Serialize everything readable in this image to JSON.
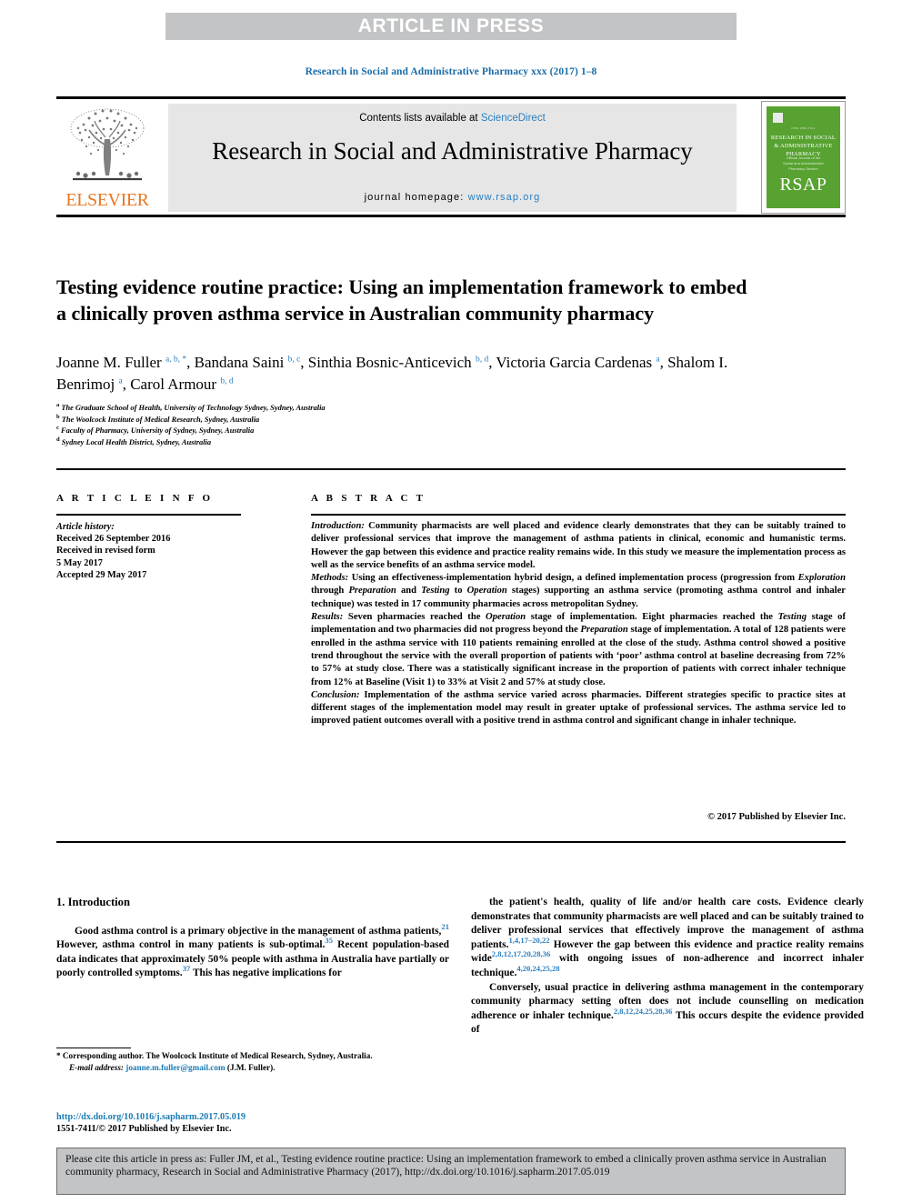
{
  "banner": {
    "label": "ARTICLE IN PRESS"
  },
  "running_head": {
    "text": "Research in Social and Administrative Pharmacy xxx (2017) 1–8"
  },
  "masthead": {
    "contents_prefix": "Contents lists available at ",
    "sciencedirect": "ScienceDirect",
    "journal_title": "Research in Social and Administrative Pharmacy",
    "homepage_label": "journal homepage: ",
    "homepage_url": "www.rsap.org",
    "publisher": "ELSEVIER",
    "cover": {
      "title": "RESEARCH IN SOCIAL & ADMINISTRATIVE PHARMACY",
      "acronym": "RSAP",
      "small_top": "ISSN 1551-7411",
      "sub": "Official Journal of the\nSocial and Administrative\nPharmacy Section"
    }
  },
  "article": {
    "title": "Testing evidence routine practice: Using an implementation framework to embed a clinically proven asthma service in Australian community pharmacy",
    "authors": [
      {
        "name": "Joanne M. Fuller",
        "marks": "a, b, *",
        "sep": ", "
      },
      {
        "name": "Bandana Saini",
        "marks": "b, c",
        "sep": ", "
      },
      {
        "name": "Sinthia Bosnic-Anticevich",
        "marks": "b, d",
        "sep": ", "
      },
      {
        "name": "Victoria Garcia Cardenas",
        "marks": "a",
        "sep": ", "
      },
      {
        "name": "Shalom I. Benrimoj",
        "marks": "a",
        "sep": ", "
      },
      {
        "name": "Carol Armour",
        "marks": "b, d",
        "sep": ""
      }
    ],
    "affiliations": [
      {
        "mark": "a",
        "text": "The Graduate School of Health, University of Technology Sydney, Sydney, Australia"
      },
      {
        "mark": "b",
        "text": "The Woolcock Institute of Medical Research, Sydney, Australia"
      },
      {
        "mark": "c",
        "text": "Faculty of Pharmacy, University of Sydney, Sydney, Australia"
      },
      {
        "mark": "d",
        "text": "Sydney Local Health District, Sydney, Australia"
      }
    ]
  },
  "article_info": {
    "heading": "A R T I C L E  I N F O",
    "history_label": "Article history:",
    "received": "Received 26 September 2016",
    "revised_label": "Received in revised form",
    "revised_date": "5 May 2017",
    "accepted": "Accepted 29 May 2017"
  },
  "abstract": {
    "heading": "A B S T R A C T",
    "sections": [
      {
        "label": "Introduction:",
        "text": " Community pharmacists are well placed and evidence clearly demonstrates that they can be suitably trained to deliver professional services that improve the management of asthma patients in clinical, economic and humanistic terms. However the gap between this evidence and practice reality remains wide. In this study we measure the implementation process as well as the service benefits of an asthma service model."
      },
      {
        "label": "Methods:",
        "text": " Using an effectiveness-implementation hybrid design, a defined implementation process (progression from Exploration through Preparation and Testing to Operation stages) supporting an asthma service (promoting asthma control and inhaler technique) was tested in 17 community pharmacies across metropolitan Sydney."
      },
      {
        "label": "Results:",
        "text": " Seven pharmacies reached the Operation stage of implementation. Eight pharmacies reached the Testing stage of implementation and two pharmacies did not progress beyond the Preparation stage of implementation. A total of 128 patients were enrolled in the asthma service with 110 patients remaining enrolled at the close of the study. Asthma control showed a positive trend throughout the service with the overall proportion of patients with ‘poor’ asthma control at baseline decreasing from 72% to 57% at study close. There was a statistically significant increase in the proportion of patients with correct inhaler technique from 12% at Baseline (Visit 1) to 33% at Visit 2 and 57% at study close."
      },
      {
        "label": "Conclusion:",
        "text": " Implementation of the asthma service varied across pharmacies. Different strategies specific to practice sites at different stages of the implementation model may result in greater uptake of professional services. The asthma service led to improved patient outcomes overall with a positive trend in asthma control and significant change in inhaler technique."
      }
    ],
    "copyright": "© 2017 Published by Elsevier Inc."
  },
  "body": {
    "section_number_title": "1. Introduction",
    "left_paragraphs": [
      "Good asthma control is a primary objective in the management of asthma patients,<sup class=\"ref\">21</sup> However, asthma control in many patients is sub-optimal.<sup class=\"ref\">35</sup> Recent population-based data indicates that approximately 50% people with asthma in Australia have partially or poorly controlled symptoms.<sup class=\"ref\">37</sup> This has negative implications for"
    ],
    "right_paragraphs": [
      "the patient's health, quality of life and/or health care costs. Evidence clearly demonstrates that community pharmacists are well placed and can be suitably trained to deliver professional services that effectively improve the management of asthma patients.<sup class=\"ref\">1,4,17–20,22</sup> However the gap between this evidence and practice reality remains wide<sup class=\"ref\">2,8,12,17,20,28,36</sup> with ongoing issues of non-adherence and incorrect inhaler technique.<sup class=\"ref\">4,20,24,25,28</sup>",
      "Conversely, usual practice in delivering asthma management in the contemporary community pharmacy setting often does not include counselling on medication adherence or inhaler technique.<sup class=\"ref\">2,8,12,24,25,28,36</sup> This occurs despite the evidence provided of"
    ]
  },
  "footnote": {
    "corresponding": "* Corresponding author. The Woolcock Institute of Medical Research, Sydney, Australia.",
    "email_label": "E-mail address:",
    "email": "joanne.m.fuller@gmail.com",
    "email_owner": "(J.M. Fuller).",
    "doi_url": "http://dx.doi.org/10.1016/j.sapharm.2017.05.019",
    "issn_line": "1551-7411/© 2017 Published by Elsevier Inc."
  },
  "cite_box": {
    "text": "Please cite this article in press as: Fuller JM, et al., Testing evidence routine practice: Using an implementation framework to embed a clinically proven asthma service in Australian community pharmacy, Research in Social and Administrative Pharmacy (2017), http://dx.doi.org/10.1016/j.sapharm.2017.05.019"
  },
  "colors": {
    "banner_bg": "#c3c4c6",
    "link_blue": "#1a7ab5",
    "accent_blue": "#2a7fc1",
    "elsevier_orange": "#e87722",
    "cover_green": "#57a231",
    "masthead_grey": "#e6e6e6"
  }
}
